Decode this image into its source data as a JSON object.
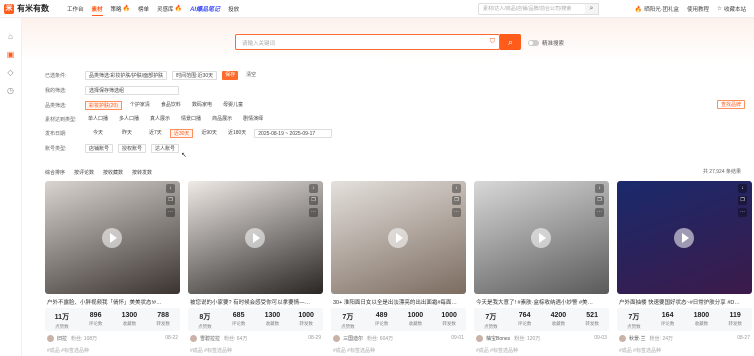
{
  "brand": {
    "name": "有米有数",
    "mark": "米"
  },
  "nav": [
    {
      "label": "工作台",
      "active": false,
      "hot": false
    },
    {
      "label": "素材",
      "active": true,
      "hot": false
    },
    {
      "label": "策略",
      "active": false,
      "hot": true
    },
    {
      "label": "榜单",
      "active": false,
      "hot": false
    },
    {
      "label": "灵感库",
      "active": false,
      "hot": true
    }
  ],
  "ai_tag": "AI爆品笔记",
  "nav_last": "投放",
  "top_search": {
    "placeholder": "素材/达人/商品/店铺/品牌/前台公司/搜索"
  },
  "top_right": {
    "account": "晒阳光·团礼盒",
    "tutorial": "使用教程",
    "favorite": "收藏本站"
  },
  "search": {
    "placeholder": "请输入关键词",
    "precise_label": "精准搜索"
  },
  "filters": {
    "selected": {
      "label": "已选条件:",
      "chips": [
        "品类筛选:彩妆护肤/护肤/面部护肤",
        "时间范围:近30天"
      ],
      "save": "保存",
      "clear": "清空"
    },
    "saved": {
      "label": "我的筛选:",
      "value": "选择保存筛选组"
    },
    "category": {
      "label": "品类筛选:",
      "options": [
        "彩妆护肤(20)",
        "个护家清",
        "食品饮料",
        "数码家电",
        "母婴儿童"
      ],
      "find_button": "查找品牌"
    },
    "account_type": {
      "label": "素材达到类型:",
      "options": [
        "单人口播",
        "多人口播",
        "真人展示",
        "情景口播",
        "商品展示",
        "剧情演绎"
      ]
    },
    "publish_time": {
      "label": "发布日期:",
      "options": [
        "今天",
        "昨天",
        "近7天",
        "近30天",
        "近90天",
        "近180天"
      ],
      "date_range": "2025-08-19 ~ 2025-09-17"
    },
    "accounts": {
      "label": "账号类型:",
      "options": [
        "店铺账号",
        "授权账号",
        "达人账号"
      ]
    }
  },
  "sort": {
    "options": [
      "综合排序",
      "按评论数",
      "按收藏数",
      "按转发数"
    ],
    "total": "共 27,924 条结果"
  },
  "cards": [
    {
      "title": "户外不露脸、小胖视频我「倘怀」美美状态!#…",
      "stats": [
        "11万",
        "896",
        "1300",
        "788"
      ],
      "labels": [
        "点赞数",
        "评论数",
        "收藏数",
        "转发数"
      ],
      "author": "旧拉",
      "fans": "粉丝: 108万",
      "tags": "#成品 #标签选品种",
      "thumb_from": "#d9d4cf",
      "thumb_to": "#3a3330"
    },
    {
      "title": "被您说的小家要? 有时候会感受你可以拿要情—…",
      "stats": [
        "8万",
        "685",
        "1300",
        "1000"
      ],
      "labels": [
        "点赞数",
        "评论数",
        "收藏数",
        "转发数"
      ],
      "author": "雪碧拉拉",
      "fans": "粉丝: 64万",
      "tags": "#成品 #标签选品种",
      "thumb_from": "#efeae6",
      "thumb_to": "#2a2624"
    },
    {
      "title": "30+ 淮阳面日女以全是出淡漂亮的出出面霜#每面…",
      "stats": [
        "7万",
        "489",
        "1000",
        "1000"
      ],
      "labels": [
        "点赞数",
        "评论数",
        "收藏数",
        "转发数"
      ],
      "author": "三国迪尔",
      "fans": "粉丝: 604万",
      "tags": "#成品 #标签选品种",
      "thumb_from": "#e4e0dc",
      "thumb_to": "#7c6c60"
    },
    {
      "title": "今天是我大意了! #素肤·盒棕收纳遇小妙警 #美…",
      "stats": [
        "7万",
        "764",
        "4200",
        "521"
      ],
      "labels": [
        "点赞数",
        "评论数",
        "收藏数",
        "转发数"
      ],
      "author": "柚宝Bones",
      "fans": "粉丝: 120万",
      "tags": "#成品 #标签选品种",
      "thumb_from": "#d8d8d8",
      "thumb_to": "#5a5a5a"
    },
    {
      "title": "户外面抽楼 快速要国好状态~#日常护肤分享 #D…",
      "stats": [
        "7万",
        "164",
        "1800",
        "119"
      ],
      "labels": [
        "点赞数",
        "评论数",
        "收藏数",
        "转发数"
      ],
      "author": "秋景·兰",
      "fans": "粉丝: 24万",
      "tags": "#成品 #标签选品种",
      "thumb_from": "#1a2a6c",
      "thumb_to": "#3c1a4a"
    }
  ],
  "card_times": [
    "08-22",
    "08-29",
    "09-01",
    "09-03",
    "08-27"
  ],
  "tool_icons": [
    "download-icon",
    "copy-icon",
    "more-icon"
  ]
}
